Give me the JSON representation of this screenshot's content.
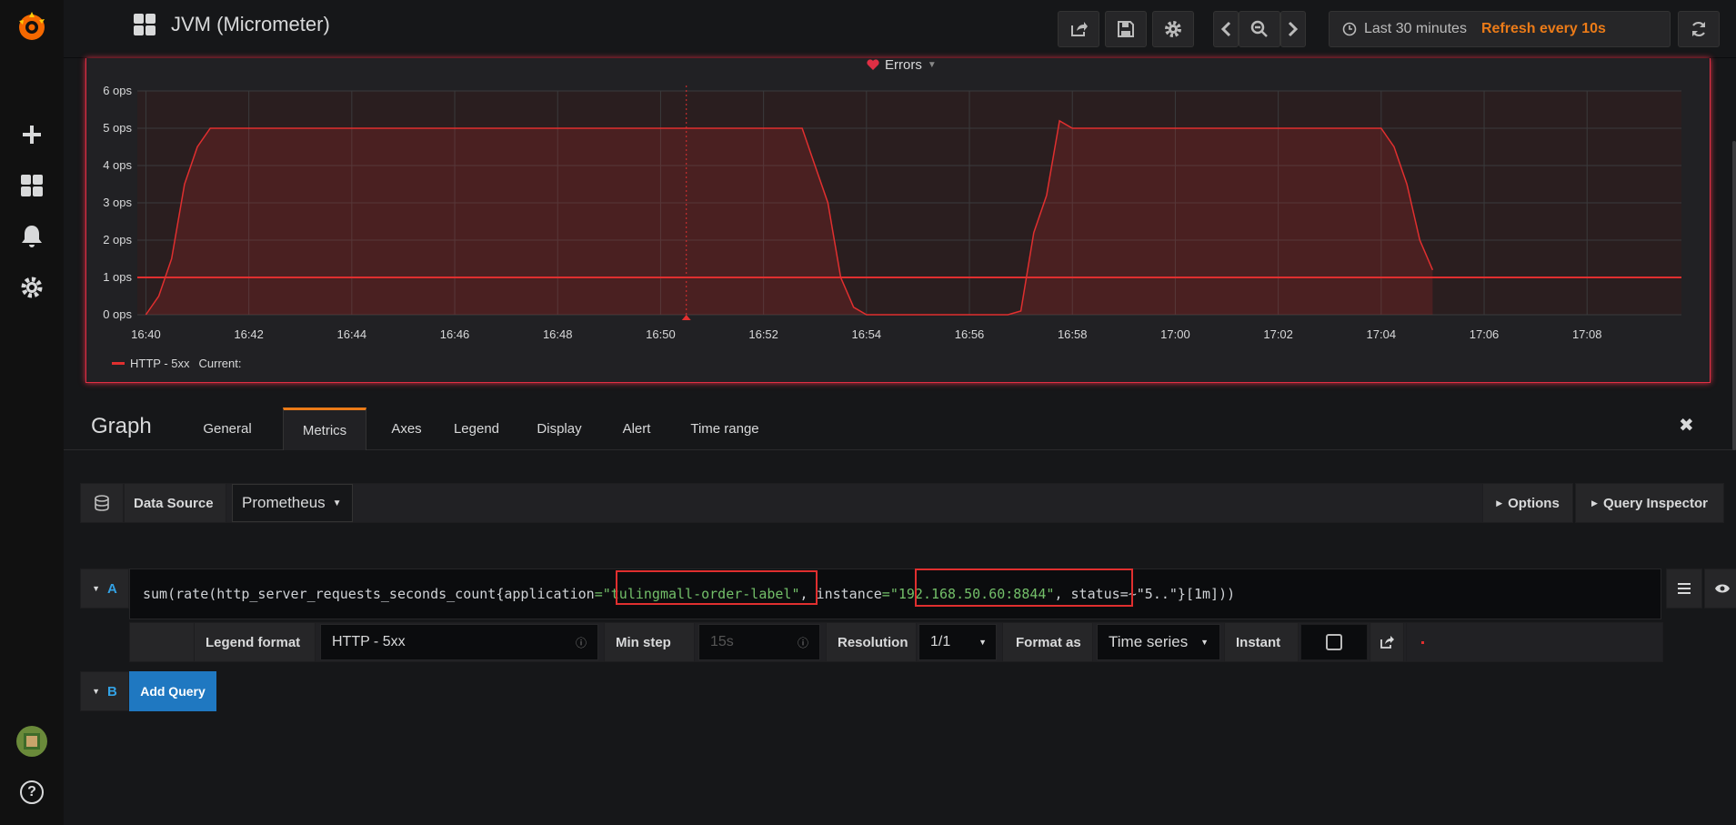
{
  "header": {
    "title": "JVM (Micrometer)",
    "time_range": "Last 30 minutes",
    "refresh": "Refresh every 10s"
  },
  "panel": {
    "title": "Errors",
    "legend_series": "HTTP - 5xx",
    "legend_current": "Current:"
  },
  "chart_data": {
    "type": "area",
    "title": "Errors",
    "yticks": [
      "0 ops",
      "1 ops",
      "2 ops",
      "3 ops",
      "4 ops",
      "5 ops",
      "6 ops"
    ],
    "xticks": [
      "16:40",
      "16:42",
      "16:44",
      "16:46",
      "16:48",
      "16:50",
      "16:52",
      "16:54",
      "16:56",
      "16:58",
      "17:00",
      "17:02",
      "17:04",
      "17:06",
      "17:08"
    ],
    "ylim": [
      0,
      6
    ],
    "series": [
      {
        "name": "HTTP - 5xx",
        "color": "#e02f2f",
        "x": [
          "16:40:00",
          "16:40:15",
          "16:40:30",
          "16:40:45",
          "16:41:00",
          "16:41:15",
          "16:41:30",
          "16:42:00",
          "16:46:00",
          "16:48:00",
          "16:50:00",
          "16:52:00",
          "16:52:45",
          "16:53:00",
          "16:53:15",
          "16:53:30",
          "16:53:45",
          "16:54:00",
          "16:54:15",
          "16:55:00",
          "16:56:00",
          "16:56:45",
          "16:57:00",
          "16:57:15",
          "16:57:30",
          "16:57:45",
          "16:58:00",
          "17:00:00",
          "17:02:00",
          "17:04:00",
          "17:04:15",
          "17:04:30",
          "17:04:45",
          "17:05:00"
        ],
        "values": [
          0,
          0.5,
          1.5,
          3.5,
          4.5,
          5,
          5,
          5,
          5,
          5,
          5,
          5,
          5,
          4,
          3,
          1,
          0.2,
          0,
          0,
          0,
          0,
          0,
          0.1,
          2.2,
          3.2,
          5.2,
          5,
          5,
          5,
          5,
          4.5,
          3.5,
          2,
          1.2
        ]
      }
    ],
    "threshold": 1
  },
  "editor": {
    "title": "Graph",
    "tabs": [
      "General",
      "Metrics",
      "Axes",
      "Legend",
      "Display",
      "Alert",
      "Time range"
    ],
    "active_tab": "Metrics",
    "data_source_label": "Data Source",
    "data_source_value": "Prometheus",
    "options_label": "Options",
    "query_inspector_label": "Query Inspector",
    "query_a": {
      "letter": "A",
      "expr": {
        "p1": "sum(rate(http_server_requests_seconds_count{application",
        "p2": "=\"tulingmall-order-label\"",
        "p3": ", instance",
        "p4": "=\"192.168.50.60:8844\"",
        "p5": ", status=~\"5..\"}[1m]))"
      },
      "legend_format_label": "Legend format",
      "legend_format_value": "HTTP - 5xx",
      "min_step_label": "Min step",
      "min_step_placeholder": "15s",
      "resolution_label": "Resolution",
      "resolution_value": "1/1",
      "format_as_label": "Format as",
      "format_as_value": "Time series",
      "instant_label": "Instant"
    },
    "query_b": {
      "letter": "B",
      "add_query_label": "Add Query"
    }
  }
}
